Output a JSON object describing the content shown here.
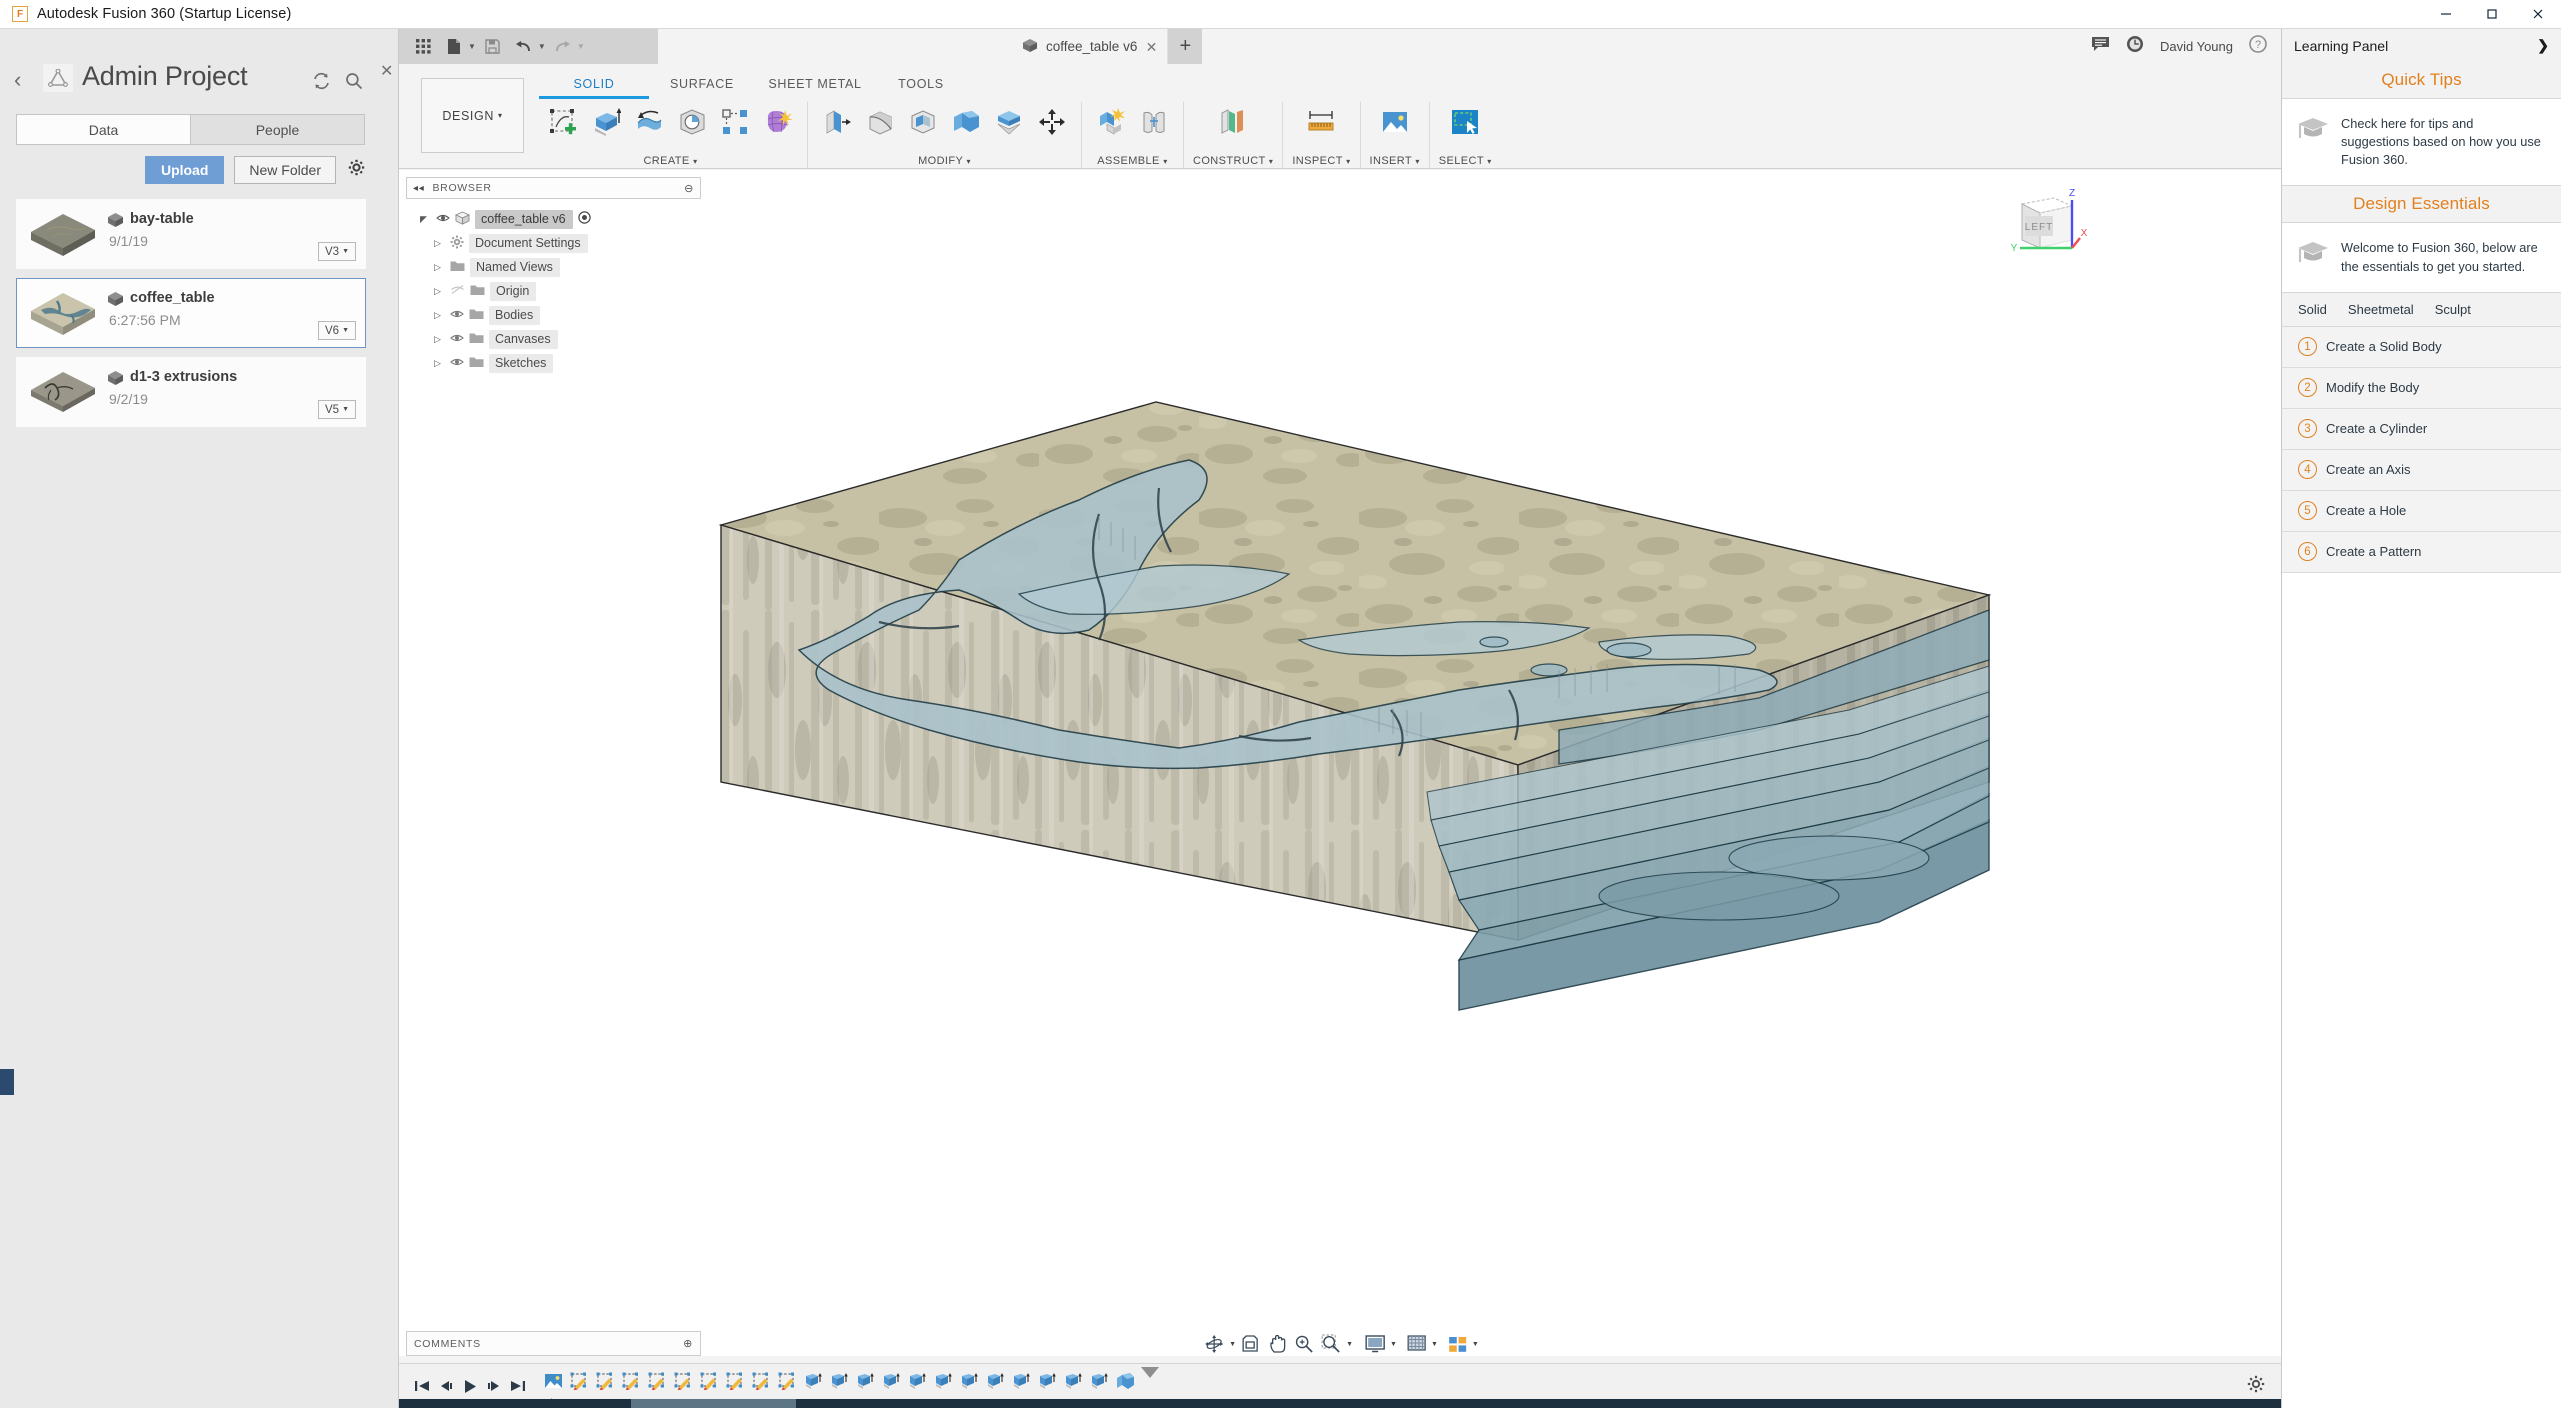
{
  "window": {
    "app_title": "Autodesk Fusion 360 (Startup License)",
    "app_icon": "fusion-logo-icon",
    "minimize_label": "–",
    "maximize_label": "☐",
    "close_label": "✕"
  },
  "data_panel": {
    "project_title": "Admin Project",
    "back_label": "‹",
    "close_label": "✕",
    "tabs": [
      {
        "label": "Data",
        "active": true
      },
      {
        "label": "People",
        "active": false
      }
    ],
    "upload_label": "Upload",
    "new_folder_label": "New Folder",
    "items": [
      {
        "name": "bay-table",
        "date": "9/1/19",
        "version": "V3",
        "selected": false,
        "thumb": "tan"
      },
      {
        "name": "coffee_table",
        "date": "6:27:56 PM",
        "version": "V6",
        "selected": true,
        "thumb": "blue"
      },
      {
        "name": "d1-3 extrusions",
        "date": "9/2/19",
        "version": "V5",
        "selected": false,
        "thumb": "grey"
      }
    ]
  },
  "quick_access": {
    "buttons": [
      "app-grid-icon",
      "new-file-icon",
      "save-icon",
      "undo-icon",
      "redo-icon"
    ]
  },
  "document_tab": {
    "title": "coffee_table v6",
    "close_label": "✕",
    "new_tab_label": "+"
  },
  "account": {
    "user_name": "David Young",
    "icons": [
      "comment-icon",
      "job-status-icon",
      "help-icon"
    ]
  },
  "ribbon": {
    "workspace_label": "DESIGN",
    "workspace_caret": "▾",
    "tabs": [
      {
        "label": "SOLID",
        "active": true
      },
      {
        "label": "SURFACE",
        "active": false
      },
      {
        "label": "SHEET METAL",
        "active": false
      },
      {
        "label": "TOOLS",
        "active": false
      }
    ],
    "groups": [
      {
        "label": "CREATE",
        "caret": "▾",
        "icon_count": 5
      },
      {
        "label": "MODIFY",
        "caret": "▾",
        "icon_count": 5
      },
      {
        "label": "",
        "caret": "",
        "icon_count": 1
      },
      {
        "label": "ASSEMBLE",
        "caret": "▾",
        "icon_count": 2
      },
      {
        "label": "CONSTRUCT",
        "caret": "▾",
        "icon_count": 1
      },
      {
        "label": "INSPECT",
        "caret": "▾",
        "icon_count": 1
      },
      {
        "label": "INSERT",
        "caret": "▾",
        "icon_count": 1
      },
      {
        "label": "SELECT",
        "caret": "▾",
        "icon_count": 1
      }
    ]
  },
  "browser": {
    "title": "BROWSER",
    "collapse_label": "◂◂",
    "settings_label": "⊖",
    "root": {
      "label": "coffee_table v6",
      "expanded": true
    },
    "nodes": [
      {
        "label": "Document Settings",
        "icon": "gear-icon",
        "visible": true
      },
      {
        "label": "Named Views",
        "icon": "folder-icon",
        "visible": true
      },
      {
        "label": "Origin",
        "icon": "folder-icon",
        "visible": false
      },
      {
        "label": "Bodies",
        "icon": "folder-icon",
        "visible": true
      },
      {
        "label": "Canvases",
        "icon": "folder-icon",
        "visible": true
      },
      {
        "label": "Sketches",
        "icon": "folder-icon",
        "visible": true
      }
    ]
  },
  "viewcube": {
    "face_label": "LEFT",
    "axis_x": "X",
    "axis_y": "Y",
    "axis_z": "Z"
  },
  "model": {
    "description": "bathymetric terrain block with water channels",
    "top_color": "#c3bda1",
    "side_color": "#cfcbbb",
    "water_color": "#a9c3cc",
    "deep_water_color": "#5e8594"
  },
  "comments": {
    "title": "COMMENTS",
    "add_label": "⊕"
  },
  "nav_bar": {
    "buttons": [
      {
        "name": "orbit-icon",
        "caret": true
      },
      {
        "name": "look-at-icon",
        "caret": false
      },
      {
        "name": "pan-icon",
        "caret": false
      },
      {
        "name": "zoom-icon",
        "caret": false
      },
      {
        "name": "zoom-window-icon",
        "caret": true
      },
      {
        "name": "display-settings-icon",
        "caret": true
      },
      {
        "name": "grid-snap-icon",
        "caret": true
      },
      {
        "name": "viewports-icon",
        "caret": true
      }
    ]
  },
  "timeline": {
    "playback": [
      "skip-to-start-icon",
      "step-back-icon",
      "play-icon",
      "step-forward-icon",
      "skip-to-end-icon"
    ],
    "canvas_feature_count": 1,
    "sketch_feature_count": 9,
    "extrude_feature_count": 12,
    "last_feature": "combine-icon",
    "settings_icon": "gear-icon"
  },
  "learning_panel": {
    "title": "Learning Panel",
    "chevron": "❯",
    "sections": [
      {
        "heading": "Quick Tips",
        "card_icon": "graduation-cap-icon",
        "card_text": "Check here for tips and suggestions based on how you use Fusion 360."
      },
      {
        "heading": "Design Essentials",
        "card_icon": "graduation-cap-icon",
        "card_text": "Welcome to Fusion 360, below are the essentials to get you started."
      }
    ],
    "tabs": [
      {
        "label": "Solid",
        "active": true
      },
      {
        "label": "Sheetmetal",
        "active": false
      },
      {
        "label": "Sculpt",
        "active": false
      }
    ],
    "steps": [
      {
        "num": "1",
        "label": "Create a Solid Body"
      },
      {
        "num": "2",
        "label": "Modify the Body"
      },
      {
        "num": "3",
        "label": "Create a Cylinder"
      },
      {
        "num": "4",
        "label": "Create an Axis"
      },
      {
        "num": "5",
        "label": "Create a Hole"
      },
      {
        "num": "6",
        "label": "Create a Pattern"
      }
    ]
  },
  "colors": {
    "accent_blue": "#1b9ae0",
    "accent_orange": "#e2801e",
    "upload_blue": "#6e9ed4",
    "panel_grey": "#e9e9e9"
  }
}
